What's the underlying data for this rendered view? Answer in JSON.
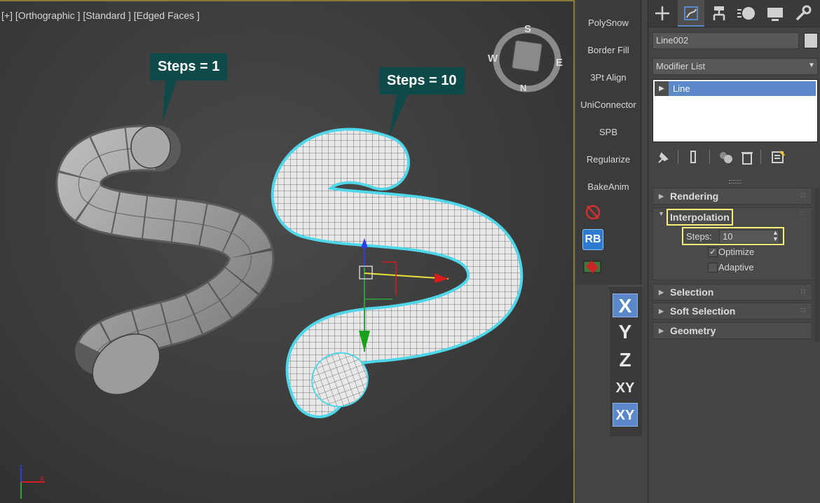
{
  "viewport": {
    "label": "[+] [Orthographic ] [Standard ] [Edged Faces ]",
    "callout_left": "Steps = 1",
    "callout_right": "Steps = 10",
    "viewcube": {
      "s": "S",
      "e": "E",
      "n": "N",
      "w": "W"
    },
    "axis_tripod": {
      "z": "z",
      "x": "x"
    }
  },
  "toolbar": {
    "items": [
      "PolySnow",
      "Border Fill",
      "3Pt Align",
      "UniConnector",
      "SPB",
      "Regularize",
      "BakeAnim"
    ],
    "rb_label": "RB"
  },
  "axis_constraints": [
    "X",
    "Y",
    "Z",
    "XY",
    "XY"
  ],
  "panel": {
    "tabs": [
      "create-icon",
      "modify-icon",
      "hierarchy-icon",
      "motion-icon",
      "display-icon",
      "utilities-icon"
    ],
    "object_name": "Line002",
    "modifier_list": "Modifier List",
    "stack_item": "Line",
    "rollouts": {
      "rendering": "Rendering",
      "interpolation": "Interpolation",
      "selection": "Selection",
      "soft_selection": "Soft Selection",
      "geometry": "Geometry"
    },
    "steps_label": "Steps:",
    "steps_value": "10",
    "optimize_label": "Optimize",
    "optimize_checked": true,
    "adaptive_label": "Adaptive",
    "adaptive_checked": false
  },
  "colors": {
    "accent": "#5b88c8",
    "highlight": "#f5f07a",
    "callout": "#0f4a4a",
    "selection": "#4fd6e8"
  }
}
